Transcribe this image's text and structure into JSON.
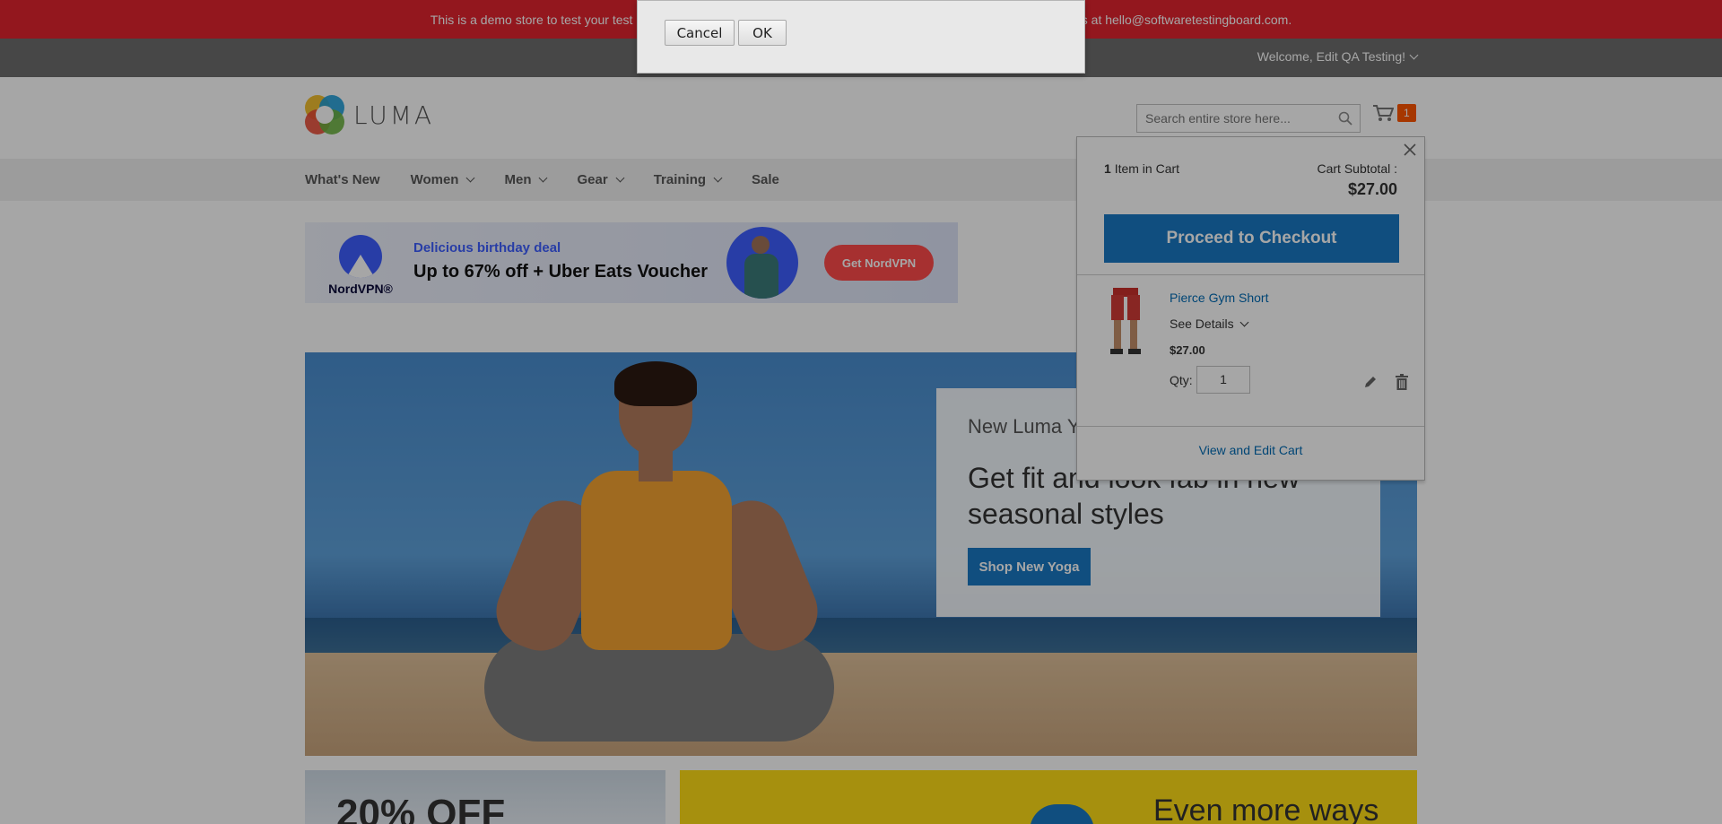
{
  "demo_notice": "This is a demo store to test your test automation scripts. No orders will be fulfilled. If you are facing any issue, email us at hello@softwaretestingboard.com.",
  "header": {
    "welcome": "Welcome, Edit QA Testing!",
    "logo_text": "LUMA",
    "search_placeholder": "Search entire store here...",
    "cart_count": "1"
  },
  "nav": {
    "items": [
      {
        "label": "What's New",
        "has_menu": false
      },
      {
        "label": "Women",
        "has_menu": true
      },
      {
        "label": "Men",
        "has_menu": true
      },
      {
        "label": "Gear",
        "has_menu": true
      },
      {
        "label": "Training",
        "has_menu": true
      },
      {
        "label": "Sale",
        "has_menu": false
      }
    ]
  },
  "ad": {
    "brand": "NordVPN®",
    "small_text": "Delicious birthday deal",
    "headline": "Up to 67% off + Uber Eats Voucher",
    "cta": "Get NordVPN"
  },
  "hero": {
    "subtitle": "New Luma Yoga Collection",
    "title": "Get fit and look fab in new seasonal styles",
    "button": "Shop New Yoga"
  },
  "promos": {
    "left": "20% OFF",
    "right": "Even more ways"
  },
  "minicart": {
    "count_number": "1",
    "count_text": "Item in Cart",
    "subtotal_label": "Cart Subtotal :",
    "subtotal_value": "$27.00",
    "checkout_label": "Proceed to Checkout",
    "item": {
      "name": "Pierce Gym Short",
      "details_label": "See Details",
      "price": "$27.00",
      "qty_label": "Qty:",
      "qty_value": "1"
    },
    "view_edit_label": "View and Edit Cart"
  },
  "dialog": {
    "cancel_label": "Cancel",
    "ok_label": "OK"
  },
  "colors": {
    "notice_red": "#e2242f",
    "header_gray": "#6e6e6e",
    "primary_blue": "#1979c3",
    "cart_badge": "#ff5501",
    "promo_yellow": "#ffdd16"
  }
}
